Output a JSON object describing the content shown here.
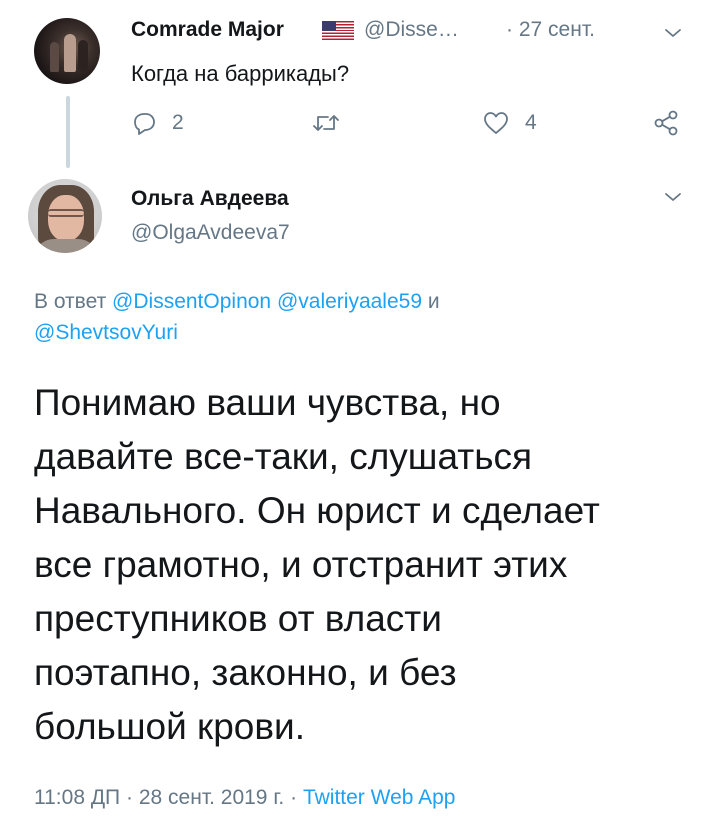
{
  "parent_tweet": {
    "author_name": "Comrade Major",
    "handle": "@Disse…",
    "separator": "·",
    "date": "27 сент.",
    "text": "Когда на баррикады?",
    "reply_count": "2",
    "retweet_count": "",
    "like_count": "4",
    "icons": [
      "us-flag-icon",
      "chevron-down-icon",
      "reply-icon",
      "retweet-icon",
      "like-icon",
      "share-icon"
    ]
  },
  "main_tweet": {
    "author_name": "Ольга Авдеева",
    "handle": "@OlgaAvdeeva7",
    "reply_prefix": "В ответ",
    "mention_1": "@DissentOpinon",
    "mention_2": "@valeriyaale59",
    "conjunction": "и",
    "mention_3": "@ShevtsovYuri",
    "text": "Понимаю ваши чувства, но\nдавайте все-таки, слушаться\nНавального. Он юрист и сделает\nвсе грамотно, и отстранит этих\nпреступников от власти\nпоэтапно, законно, и без\nбольшой крови.",
    "time": "11:08 ДП",
    "date": "28 сент. 2019 г.",
    "separator": "·",
    "source_app": "Twitter Web App"
  },
  "colors": {
    "text": "#14171a",
    "secondary": "#657786",
    "link": "#1da1f2",
    "thread_line": "#ccd6dd"
  }
}
